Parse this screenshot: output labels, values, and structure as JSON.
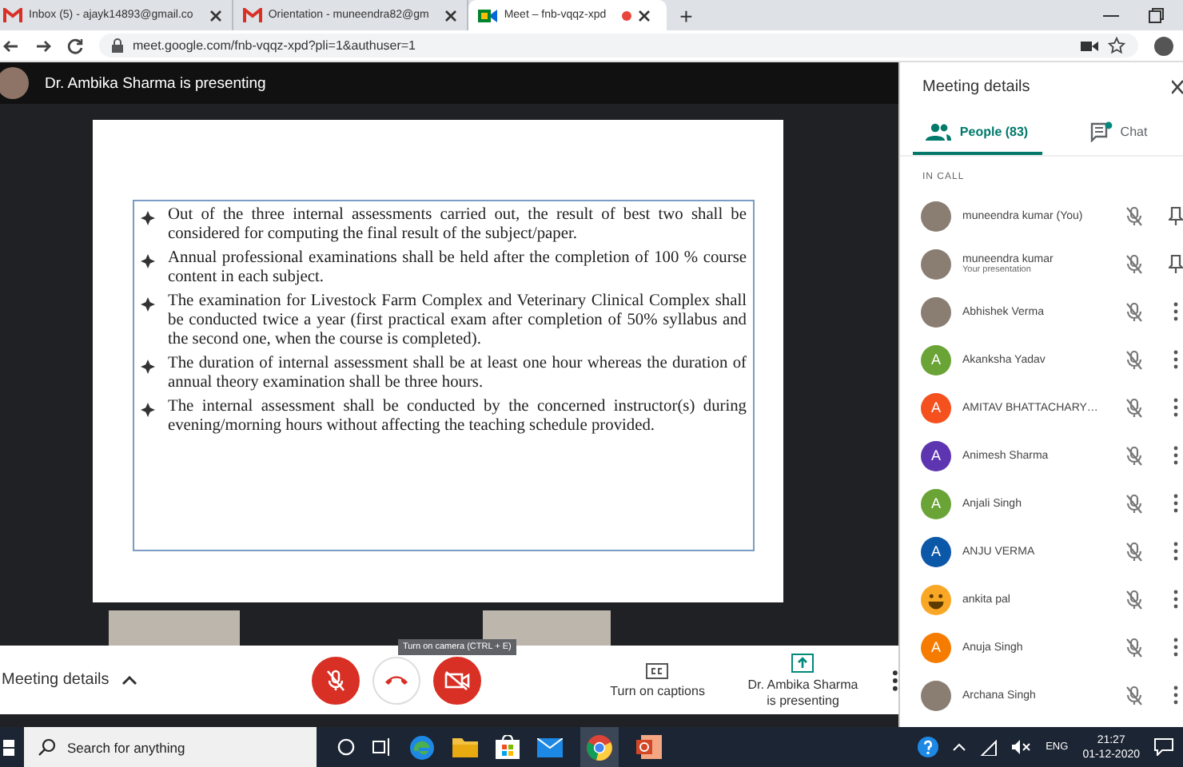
{
  "browser": {
    "tabs": [
      {
        "title": "Inbox (5) - ajayk14893@gmail.co",
        "kind": "mail",
        "selected": false,
        "recording": false
      },
      {
        "title": "Orientation - muneendra82@gm",
        "kind": "mail",
        "selected": false,
        "recording": false
      },
      {
        "title": "Meet – fnb-vqqz-xpd",
        "kind": "meet",
        "selected": true,
        "recording": true
      }
    ],
    "new_tab": "+",
    "url": "meet.google.com/fnb-vqqz-xpd?pli=1&authuser=1"
  },
  "presenter_banner": "Dr. Ambika Sharma is presenting",
  "slide": {
    "bullets": [
      "Out of the three internal assessments carried out, the result of best two shall be considered for computing the final result of the subject/paper.",
      "Annual professional examinations shall be held after the completion of 100 % course content in each subject.",
      "The examination for Livestock Farm Complex and Veterinary Clinical Complex shall be conducted twice a year (first practical exam after completion of 50% syllabus and the second one, when the course is completed).",
      "The duration of internal assessment shall be at least one hour whereas the duration of annual theory examination shall be three hours.",
      "The internal assessment shall be conducted by the concerned instructor(s) during evening/morning hours without affecting the teaching schedule provided."
    ]
  },
  "controls": {
    "meeting_details": "Meeting details",
    "mic_muted": true,
    "camera_off": true,
    "tooltip": "Turn on camera (CTRL + E)",
    "captions": "Turn on captions",
    "presenting": [
      "Dr. Ambika Sharma",
      "is presenting"
    ]
  },
  "panel": {
    "title": "Meeting details",
    "tabs": [
      {
        "label": "People (83)",
        "kind": "people",
        "selected": true
      },
      {
        "label": "Chat",
        "kind": "chat",
        "selected": false
      }
    ],
    "section": "IN CALL",
    "participants": [
      {
        "name": "muneendra kumar (You)",
        "avatar": {
          "kind": "photo"
        },
        "muted": true,
        "action": {
          "kind": "pin"
        }
      },
      {
        "name": "muneendra kumar",
        "subtitle": "Your presentation",
        "avatar": {
          "kind": "photo"
        },
        "muted": true,
        "action": {
          "kind": "pin"
        }
      },
      {
        "name": "Abhishek Verma",
        "avatar": {
          "kind": "photo"
        },
        "muted": true,
        "action": {
          "kind": "more"
        }
      },
      {
        "name": "Akanksha Yadav",
        "avatar": {
          "kind": "letter",
          "letter": "A",
          "color": "#6aa336"
        },
        "muted": true,
        "action": {
          "kind": "more"
        }
      },
      {
        "name": "AMITAV BHATTACHARY…",
        "avatar": {
          "kind": "letter",
          "letter": "A",
          "color": "#f4511e"
        },
        "muted": true,
        "action": {
          "kind": "more"
        }
      },
      {
        "name": "Animesh Sharma",
        "avatar": {
          "kind": "letter",
          "letter": "A",
          "color": "#5e35b1"
        },
        "muted": true,
        "action": {
          "kind": "more"
        }
      },
      {
        "name": "Anjali Singh",
        "avatar": {
          "kind": "letter",
          "letter": "A",
          "color": "#6aa336"
        },
        "muted": true,
        "action": {
          "kind": "more"
        }
      },
      {
        "name": "ANJU VERMA",
        "avatar": {
          "kind": "letter",
          "letter": "A",
          "color": "#0b57a8"
        },
        "muted": true,
        "action": {
          "kind": "more"
        }
      },
      {
        "name": "ankita pal",
        "avatar": {
          "kind": "emoji"
        },
        "muted": true,
        "action": {
          "kind": "more"
        }
      },
      {
        "name": "Anuja Singh",
        "avatar": {
          "kind": "letter",
          "letter": "A",
          "color": "#f57c00"
        },
        "muted": true,
        "action": {
          "kind": "more"
        }
      },
      {
        "name": "Archana Singh",
        "avatar": {
          "kind": "photo"
        },
        "muted": true,
        "action": {
          "kind": "more"
        }
      }
    ]
  },
  "taskbar": {
    "search_placeholder": "Search for anything",
    "language": "ENG",
    "time": "21:27",
    "date": "01-12-2020"
  }
}
